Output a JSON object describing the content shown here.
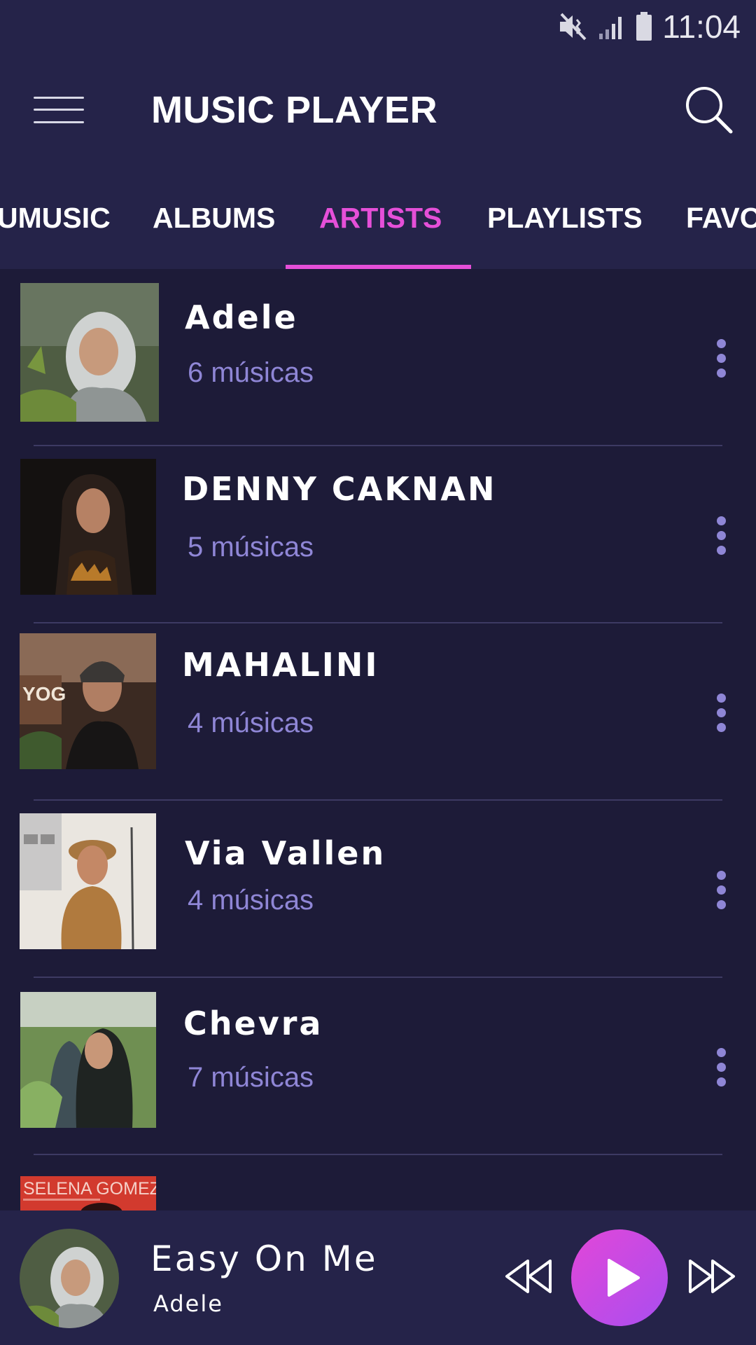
{
  "status_bar": {
    "time": "11:04"
  },
  "app_bar": {
    "title": "MUSIC PLAYER"
  },
  "tabs": [
    {
      "label": "UMUSIC"
    },
    {
      "label": "ALBUMS"
    },
    {
      "label": "ARTISTS",
      "active": true
    },
    {
      "label": "PLAYLISTS"
    },
    {
      "label": "FAVO"
    }
  ],
  "artists": [
    {
      "name": "Adele",
      "count": "6 músicas"
    },
    {
      "name": "DENNY CAKNAN",
      "count": "5 músicas"
    },
    {
      "name": "MAHALINI",
      "count": "4 músicas"
    },
    {
      "name": "Via Vallen",
      "count": "4 músicas"
    },
    {
      "name": "Chevra",
      "count": "7 músicas"
    }
  ],
  "partial_thumb_text": "SELENA GOMEZ",
  "now_playing": {
    "title": "Easy On Me",
    "artist": "Adele"
  },
  "colors": {
    "accent": "#e54fd8",
    "background": "#1d1b38",
    "bar": "#252349",
    "muted": "#8f86d6"
  },
  "icons": [
    "menu-icon",
    "search-icon",
    "more-vert-icon",
    "rewind-icon",
    "play-icon",
    "fast-forward-icon",
    "mute-icon",
    "signal-icon",
    "battery-icon"
  ]
}
